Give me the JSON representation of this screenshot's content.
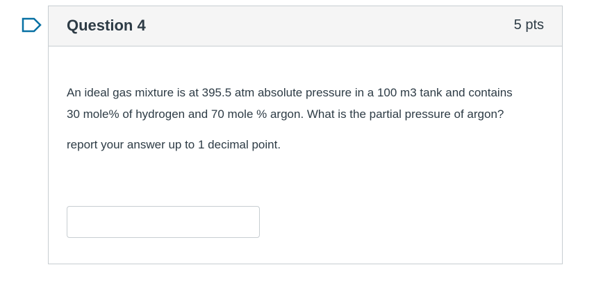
{
  "flag": {
    "icon": "flag-icon",
    "color": "#0770a3"
  },
  "question": {
    "title": "Question 4",
    "points": "5 pts",
    "text": "An ideal gas mixture is at 395.5 atm absolute pressure in a 100 m3 tank and contains 30 mole% of hydrogen and 70 mole % argon. What is the partial pressure of argon?",
    "note": "report your answer up to 1 decimal point.",
    "answer": {
      "value": "",
      "placeholder": ""
    }
  },
  "colors": {
    "header_bg": "#f5f5f5",
    "border": "#c7cdd1",
    "text": "#2d3b45",
    "accent": "#0770a3"
  }
}
